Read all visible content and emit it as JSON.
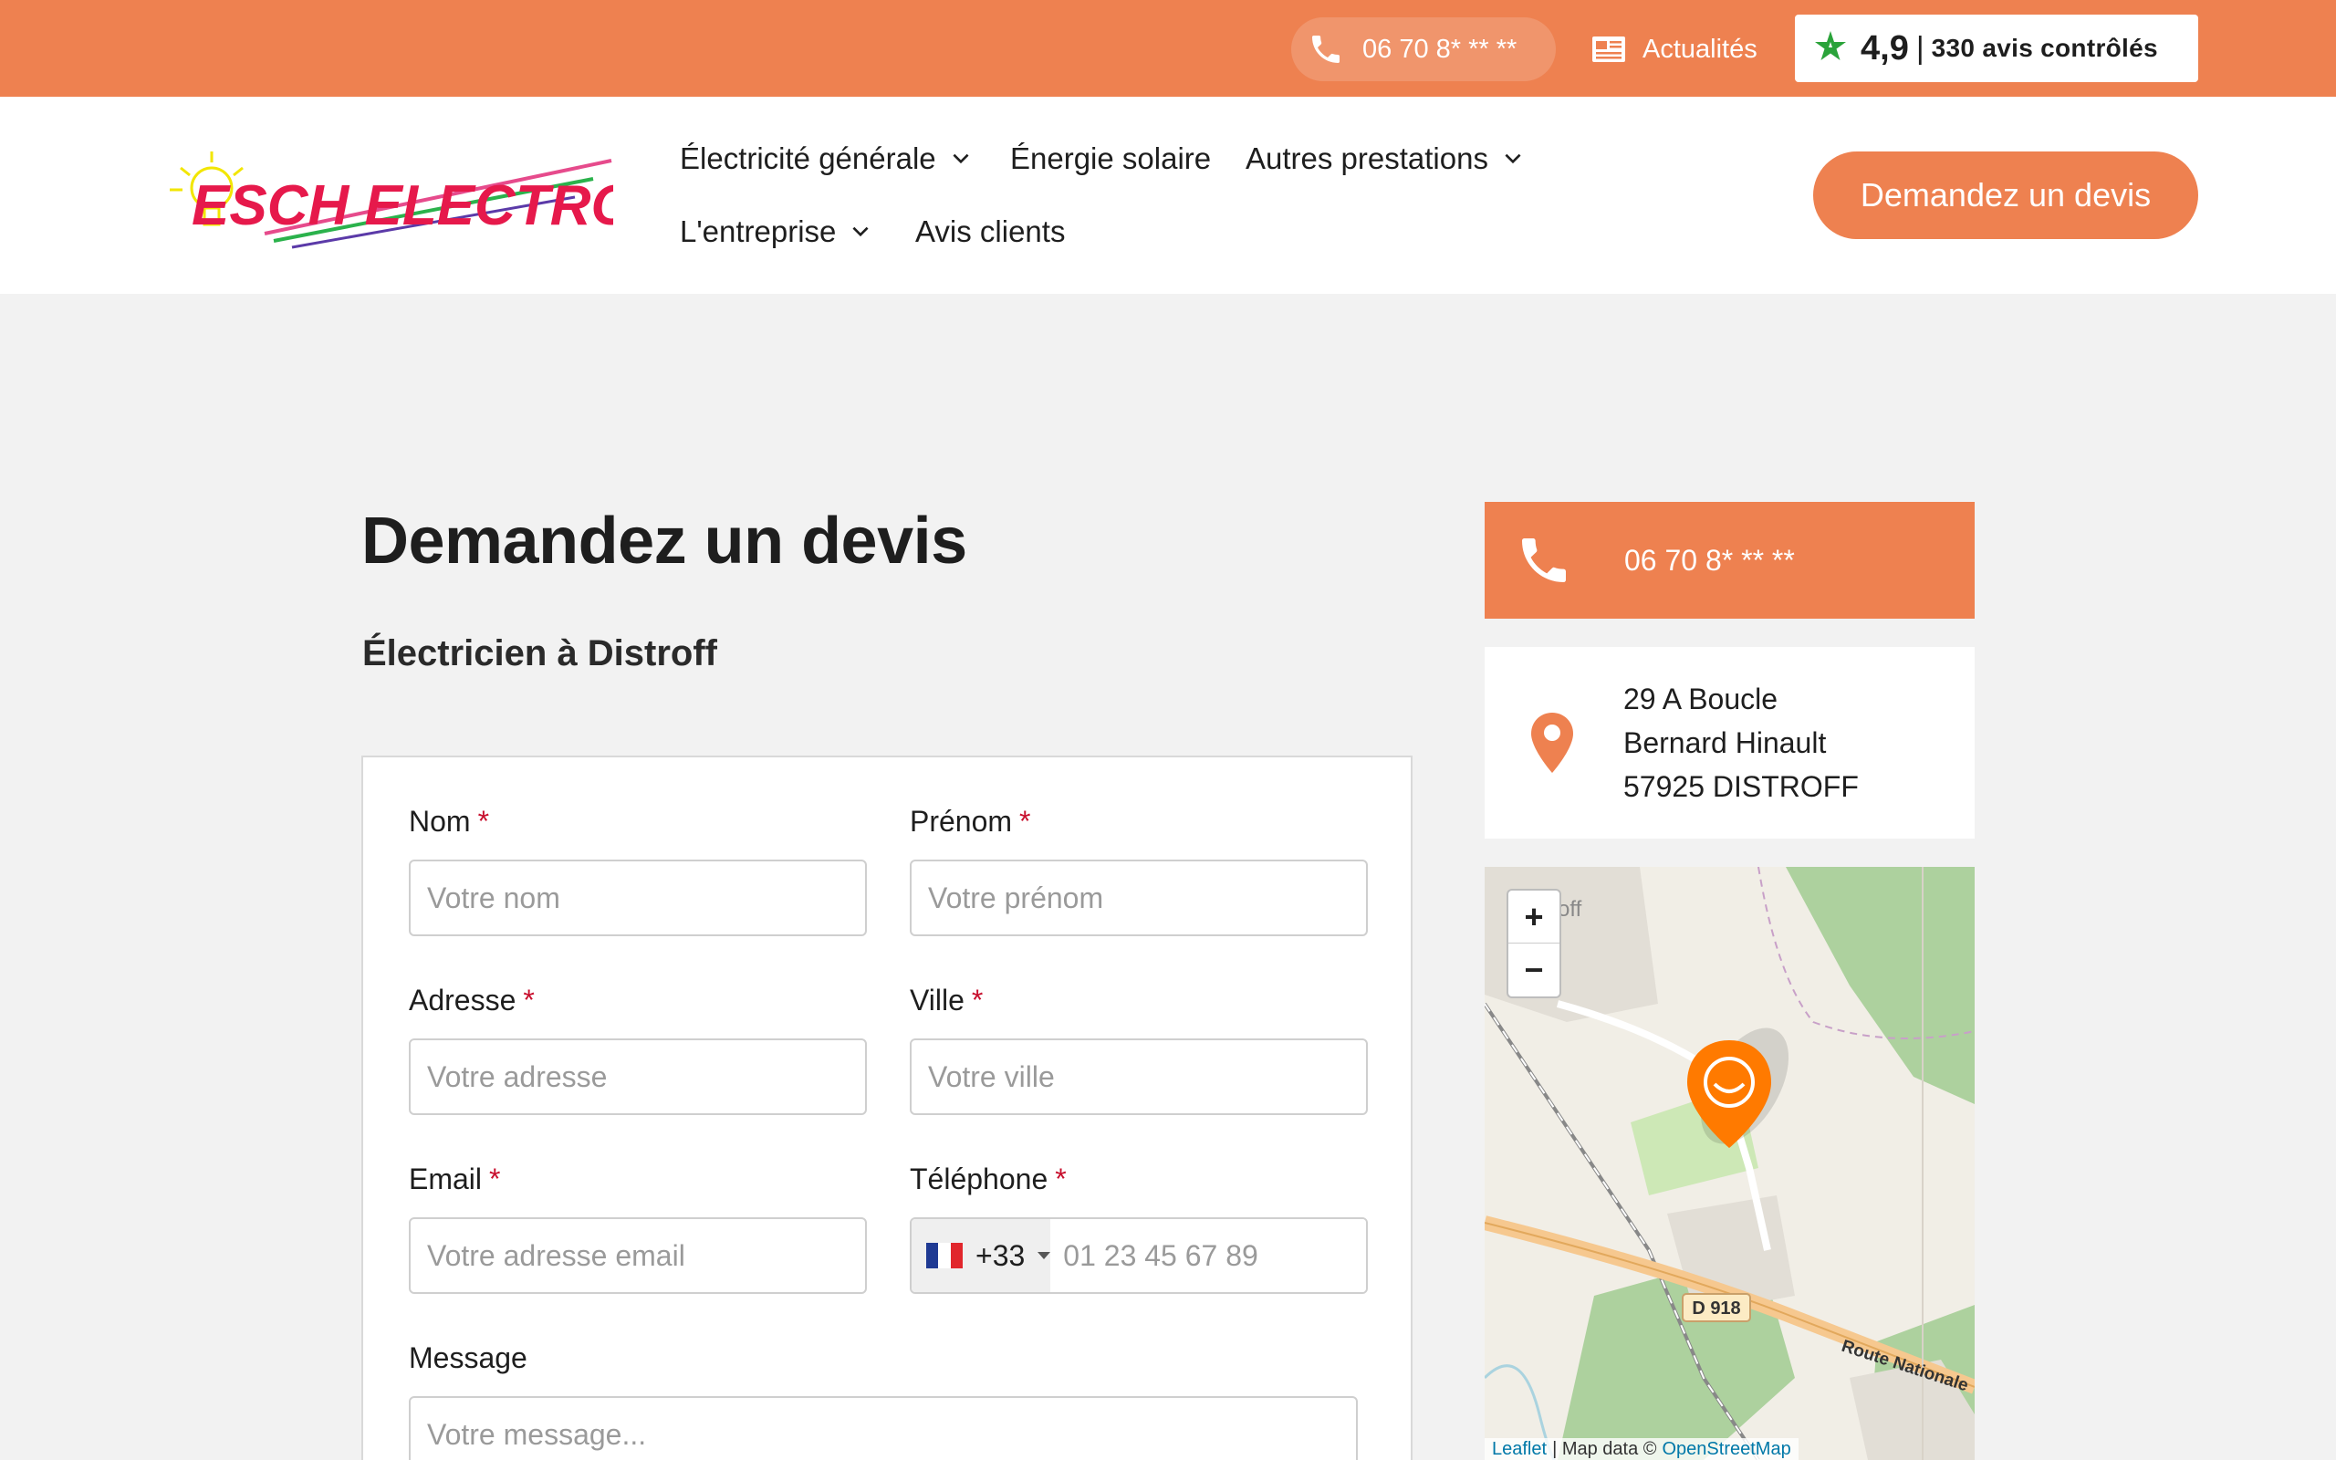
{
  "topbar": {
    "phone": "06 70 8* ** **",
    "news_label": "Actualités",
    "rating_score": "4,9",
    "rating_separator": "|",
    "rating_reviews": "330 avis contrôlés"
  },
  "brand": {
    "logo_text": "ESCH ELECTRO"
  },
  "nav": {
    "items": [
      {
        "label": "Électricité générale"
      },
      {
        "label": "Énergie solaire"
      },
      {
        "label": "Autres prestations"
      },
      {
        "label": "L'entreprise"
      },
      {
        "label": "Avis clients"
      }
    ],
    "cta_label": "Demandez un devis"
  },
  "main": {
    "title": "Demandez un devis",
    "subtitle": "Électricien à Distroff"
  },
  "form": {
    "required_mark": "*",
    "last_name": {
      "label": "Nom",
      "placeholder": "Votre nom"
    },
    "first_name": {
      "label": "Prénom",
      "placeholder": "Votre prénom"
    },
    "address": {
      "label": "Adresse",
      "placeholder": "Votre adresse"
    },
    "city": {
      "label": "Ville",
      "placeholder": "Votre ville"
    },
    "email": {
      "label": "Email",
      "placeholder": "Votre adresse email"
    },
    "phone": {
      "label": "Téléphone",
      "dial_code": "+33",
      "placeholder": "01 23 45 67 89"
    },
    "message": {
      "label": "Message",
      "placeholder": "Votre message..."
    }
  },
  "sidebar": {
    "phone": "06 70 8* ** **",
    "address_lines": [
      "29 A Boucle",
      "Bernard Hinault",
      "57925 DISTROFF"
    ]
  },
  "map": {
    "zoom_in": "+",
    "zoom_out": "−",
    "road_d918": "D 918",
    "road_nationale": "Route Nationale",
    "place_partial": "off",
    "attribution_leaflet": "Leaflet",
    "attribution_mid": "| Map data ©",
    "attribution_osm": "OpenStreetMap"
  },
  "colors": {
    "accent": "#ee8150",
    "required": "#c8102e",
    "marker": "#ff7a00"
  }
}
